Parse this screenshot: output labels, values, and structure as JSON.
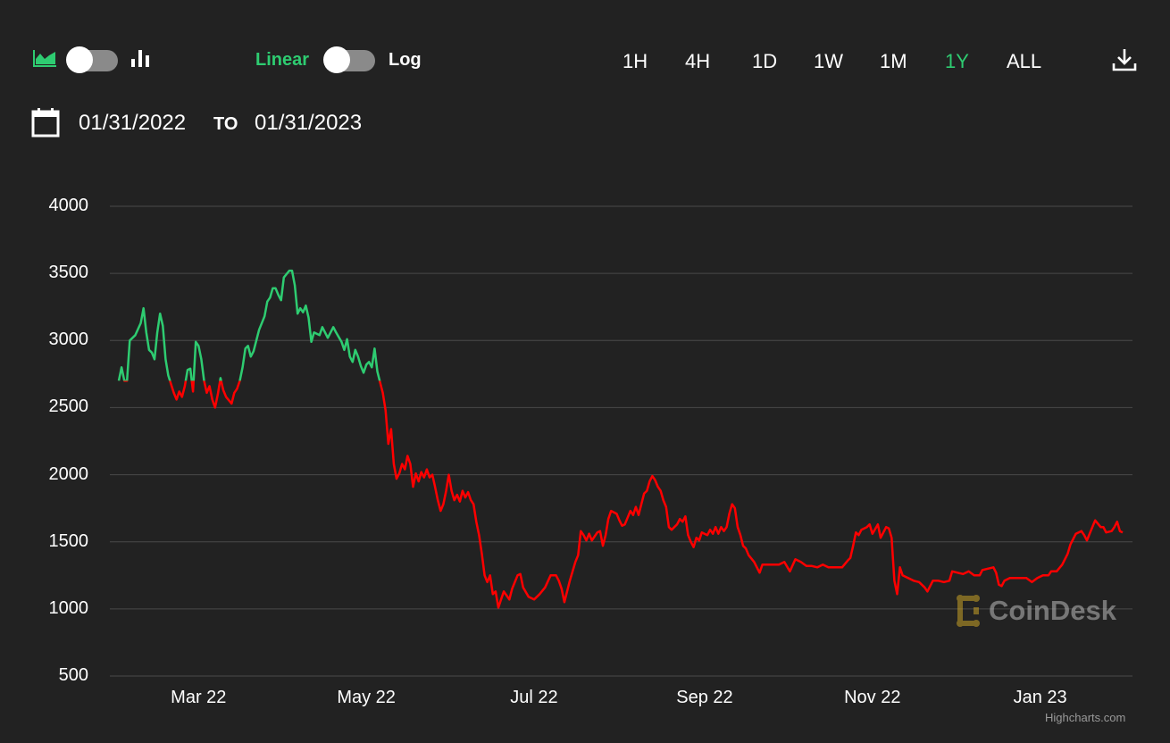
{
  "toolbar": {
    "chart_type_toggle": {
      "left_icon": "area-chart-icon",
      "right_icon": "bar-chart-icon",
      "selected": "area"
    },
    "scale_toggle": {
      "left_label": "Linear",
      "right_label": "Log",
      "selected": "Linear"
    },
    "ranges": [
      "1H",
      "4H",
      "1D",
      "1W",
      "1M",
      "1Y",
      "ALL"
    ],
    "selected_range": "1Y",
    "download_icon": "download-icon"
  },
  "date_range": {
    "from": "01/31/2022",
    "to_label": "TO",
    "to": "01/31/2023",
    "icon": "calendar-icon"
  },
  "watermark": "CoinDesk",
  "credits": "Highcharts.com",
  "colors": {
    "background": "#222222",
    "accent": "#2ecc71",
    "up": "#2ecc71",
    "down": "#ff0000",
    "grid": "#4a4a4a"
  },
  "chart_data": {
    "type": "line",
    "title": "",
    "xlabel": "",
    "ylabel": "",
    "x_unit": "days since 01/31/2022",
    "ylim": [
      500,
      4000
    ],
    "yticks": [
      4000,
      3500,
      3000,
      2500,
      2000,
      1500,
      1000,
      500
    ],
    "xticks": [
      {
        "label": "Mar 22",
        "day": 29
      },
      {
        "label": "May 22",
        "day": 90
      },
      {
        "label": "Jul 22",
        "day": 151
      },
      {
        "label": "Sep 22",
        "day": 213
      },
      {
        "label": "Nov 22",
        "day": 274
      },
      {
        "label": "Jan 23",
        "day": 335
      }
    ],
    "xlim": [
      0,
      365
    ],
    "grid": true,
    "threshold": 2700,
    "series": [
      {
        "name": "Price",
        "points": [
          [
            0,
            2700
          ],
          [
            1,
            2800
          ],
          [
            2,
            2700
          ],
          [
            3,
            2700
          ],
          [
            4,
            3000
          ],
          [
            6,
            3040
          ],
          [
            8,
            3130
          ],
          [
            9,
            3240
          ],
          [
            10,
            3060
          ],
          [
            11,
            2930
          ],
          [
            12,
            2910
          ],
          [
            13,
            2860
          ],
          [
            14,
            3060
          ],
          [
            15,
            3200
          ],
          [
            16,
            3110
          ],
          [
            17,
            2860
          ],
          [
            18,
            2740
          ],
          [
            20,
            2610
          ],
          [
            21,
            2560
          ],
          [
            22,
            2620
          ],
          [
            23,
            2580
          ],
          [
            24,
            2660
          ],
          [
            25,
            2780
          ],
          [
            26,
            2790
          ],
          [
            27,
            2620
          ],
          [
            28,
            2990
          ],
          [
            29,
            2960
          ],
          [
            30,
            2860
          ],
          [
            31,
            2700
          ],
          [
            32,
            2610
          ],
          [
            33,
            2660
          ],
          [
            34,
            2560
          ],
          [
            35,
            2500
          ],
          [
            36,
            2600
          ],
          [
            37,
            2720
          ],
          [
            38,
            2630
          ],
          [
            39,
            2580
          ],
          [
            41,
            2530
          ],
          [
            42,
            2610
          ],
          [
            43,
            2640
          ],
          [
            44,
            2700
          ],
          [
            45,
            2800
          ],
          [
            46,
            2940
          ],
          [
            47,
            2960
          ],
          [
            48,
            2880
          ],
          [
            49,
            2920
          ],
          [
            50,
            3000
          ],
          [
            51,
            3080
          ],
          [
            53,
            3180
          ],
          [
            54,
            3290
          ],
          [
            55,
            3320
          ],
          [
            56,
            3390
          ],
          [
            57,
            3390
          ],
          [
            58,
            3340
          ],
          [
            59,
            3300
          ],
          [
            60,
            3470
          ],
          [
            62,
            3520
          ],
          [
            63,
            3520
          ],
          [
            64,
            3410
          ],
          [
            65,
            3200
          ],
          [
            66,
            3240
          ],
          [
            67,
            3210
          ],
          [
            68,
            3260
          ],
          [
            69,
            3170
          ],
          [
            70,
            2990
          ],
          [
            71,
            3060
          ],
          [
            73,
            3040
          ],
          [
            74,
            3100
          ],
          [
            76,
            3020
          ],
          [
            77,
            3060
          ],
          [
            78,
            3100
          ],
          [
            79,
            3060
          ],
          [
            81,
            2990
          ],
          [
            82,
            2930
          ],
          [
            83,
            3010
          ],
          [
            84,
            2880
          ],
          [
            85,
            2840
          ],
          [
            86,
            2930
          ],
          [
            87,
            2880
          ],
          [
            88,
            2810
          ],
          [
            89,
            2760
          ],
          [
            90,
            2820
          ],
          [
            91,
            2840
          ],
          [
            92,
            2800
          ],
          [
            93,
            2940
          ],
          [
            94,
            2770
          ],
          [
            95,
            2690
          ],
          [
            96,
            2610
          ],
          [
            97,
            2480
          ],
          [
            98,
            2230
          ],
          [
            99,
            2340
          ],
          [
            100,
            2080
          ],
          [
            101,
            1970
          ],
          [
            102,
            2010
          ],
          [
            103,
            2080
          ],
          [
            104,
            2040
          ],
          [
            105,
            2140
          ],
          [
            106,
            2080
          ],
          [
            107,
            1910
          ],
          [
            108,
            2010
          ],
          [
            109,
            1950
          ],
          [
            110,
            2020
          ],
          [
            111,
            1980
          ],
          [
            112,
            2040
          ],
          [
            113,
            1980
          ],
          [
            114,
            2000
          ],
          [
            115,
            1910
          ],
          [
            116,
            1810
          ],
          [
            117,
            1730
          ],
          [
            118,
            1780
          ],
          [
            119,
            1880
          ],
          [
            120,
            2000
          ],
          [
            121,
            1880
          ],
          [
            122,
            1810
          ],
          [
            123,
            1850
          ],
          [
            124,
            1800
          ],
          [
            125,
            1880
          ],
          [
            126,
            1830
          ],
          [
            127,
            1870
          ],
          [
            128,
            1810
          ],
          [
            129,
            1780
          ],
          [
            130,
            1650
          ],
          [
            131,
            1550
          ],
          [
            132,
            1410
          ],
          [
            133,
            1250
          ],
          [
            134,
            1200
          ],
          [
            135,
            1250
          ],
          [
            136,
            1110
          ],
          [
            137,
            1130
          ],
          [
            138,
            1010
          ],
          [
            139,
            1070
          ],
          [
            140,
            1130
          ],
          [
            142,
            1070
          ],
          [
            143,
            1150
          ],
          [
            145,
            1250
          ],
          [
            146,
            1260
          ],
          [
            147,
            1160
          ],
          [
            149,
            1090
          ],
          [
            151,
            1070
          ],
          [
            153,
            1110
          ],
          [
            155,
            1160
          ],
          [
            157,
            1250
          ],
          [
            159,
            1250
          ],
          [
            160,
            1210
          ],
          [
            161,
            1150
          ],
          [
            162,
            1050
          ],
          [
            164,
            1210
          ],
          [
            166,
            1350
          ],
          [
            167,
            1400
          ],
          [
            168,
            1580
          ],
          [
            169,
            1550
          ],
          [
            170,
            1510
          ],
          [
            171,
            1560
          ],
          [
            172,
            1510
          ],
          [
            174,
            1570
          ],
          [
            175,
            1580
          ],
          [
            176,
            1470
          ],
          [
            177,
            1550
          ],
          [
            178,
            1670
          ],
          [
            179,
            1730
          ],
          [
            181,
            1710
          ],
          [
            182,
            1660
          ],
          [
            183,
            1620
          ],
          [
            184,
            1630
          ],
          [
            185,
            1680
          ],
          [
            186,
            1730
          ],
          [
            187,
            1700
          ],
          [
            188,
            1760
          ],
          [
            189,
            1700
          ],
          [
            190,
            1780
          ],
          [
            191,
            1860
          ],
          [
            192,
            1880
          ],
          [
            193,
            1950
          ],
          [
            194,
            1990
          ],
          [
            195,
            1960
          ],
          [
            196,
            1910
          ],
          [
            197,
            1880
          ],
          [
            198,
            1810
          ],
          [
            199,
            1760
          ],
          [
            200,
            1610
          ],
          [
            201,
            1590
          ],
          [
            202,
            1610
          ],
          [
            203,
            1630
          ],
          [
            204,
            1670
          ],
          [
            205,
            1650
          ],
          [
            206,
            1690
          ],
          [
            207,
            1550
          ],
          [
            208,
            1500
          ],
          [
            209,
            1460
          ],
          [
            210,
            1530
          ],
          [
            211,
            1510
          ],
          [
            212,
            1570
          ],
          [
            214,
            1550
          ],
          [
            215,
            1590
          ],
          [
            216,
            1560
          ],
          [
            217,
            1610
          ],
          [
            218,
            1560
          ],
          [
            219,
            1610
          ],
          [
            220,
            1580
          ],
          [
            221,
            1610
          ],
          [
            222,
            1710
          ],
          [
            223,
            1780
          ],
          [
            224,
            1750
          ],
          [
            225,
            1610
          ],
          [
            226,
            1550
          ],
          [
            227,
            1470
          ],
          [
            228,
            1450
          ],
          [
            229,
            1400
          ],
          [
            231,
            1350
          ],
          [
            233,
            1270
          ],
          [
            234,
            1330
          ],
          [
            236,
            1330
          ],
          [
            238,
            1330
          ],
          [
            240,
            1330
          ],
          [
            242,
            1350
          ],
          [
            244,
            1280
          ],
          [
            246,
            1370
          ],
          [
            248,
            1350
          ],
          [
            250,
            1320
          ],
          [
            252,
            1320
          ],
          [
            254,
            1310
          ],
          [
            256,
            1330
          ],
          [
            258,
            1310
          ],
          [
            259,
            1310
          ],
          [
            261,
            1310
          ],
          [
            263,
            1310
          ],
          [
            265,
            1360
          ],
          [
            266,
            1380
          ],
          [
            267,
            1470
          ],
          [
            268,
            1570
          ],
          [
            269,
            1550
          ],
          [
            270,
            1590
          ],
          [
            272,
            1610
          ],
          [
            273,
            1630
          ],
          [
            274,
            1560
          ],
          [
            276,
            1630
          ],
          [
            277,
            1530
          ],
          [
            279,
            1610
          ],
          [
            280,
            1600
          ],
          [
            281,
            1530
          ],
          [
            282,
            1210
          ],
          [
            283,
            1110
          ],
          [
            284,
            1310
          ],
          [
            285,
            1250
          ],
          [
            287,
            1230
          ],
          [
            289,
            1210
          ],
          [
            291,
            1200
          ],
          [
            293,
            1160
          ],
          [
            294,
            1130
          ],
          [
            296,
            1210
          ],
          [
            298,
            1210
          ],
          [
            300,
            1200
          ],
          [
            302,
            1210
          ],
          [
            303,
            1280
          ],
          [
            305,
            1270
          ],
          [
            307,
            1260
          ],
          [
            309,
            1280
          ],
          [
            311,
            1250
          ],
          [
            313,
            1250
          ],
          [
            314,
            1290
          ],
          [
            316,
            1300
          ],
          [
            318,
            1310
          ],
          [
            319,
            1270
          ],
          [
            320,
            1180
          ],
          [
            321,
            1170
          ],
          [
            322,
            1210
          ],
          [
            324,
            1230
          ],
          [
            326,
            1230
          ],
          [
            328,
            1230
          ],
          [
            330,
            1230
          ],
          [
            332,
            1200
          ],
          [
            334,
            1230
          ],
          [
            336,
            1250
          ],
          [
            338,
            1250
          ],
          [
            339,
            1280
          ],
          [
            341,
            1280
          ],
          [
            343,
            1330
          ],
          [
            345,
            1410
          ],
          [
            346,
            1480
          ],
          [
            348,
            1560
          ],
          [
            350,
            1580
          ],
          [
            351,
            1550
          ],
          [
            352,
            1510
          ],
          [
            353,
            1560
          ],
          [
            354,
            1610
          ],
          [
            355,
            1660
          ],
          [
            357,
            1610
          ],
          [
            358,
            1610
          ],
          [
            359,
            1570
          ],
          [
            361,
            1580
          ],
          [
            362,
            1610
          ],
          [
            363,
            1650
          ],
          [
            364,
            1580
          ],
          [
            365,
            1570
          ]
        ]
      }
    ]
  }
}
